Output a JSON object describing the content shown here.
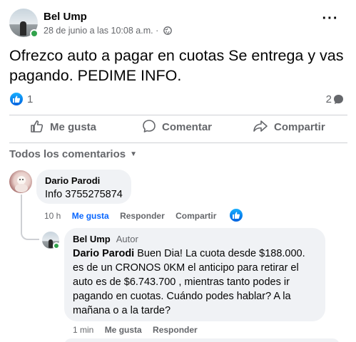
{
  "post": {
    "author": "Bel Ump",
    "timestamp": "28 de junio a las 10:08 a.m.",
    "separator": "·",
    "text": "Ofrezco auto a pagar en cuotas Se entrega y vas pagando. PEDIME INFO.",
    "reaction_count": "1",
    "comment_count": "2"
  },
  "actions": {
    "like": "Me gusta",
    "comment": "Comentar",
    "share": "Compartir"
  },
  "comments_header": "Todos los comentarios",
  "comments": [
    {
      "author": "Dario Parodi",
      "text": "Info 3755275874",
      "time": "10 h",
      "like": "Me gusta",
      "reply": "Responder",
      "share": "Compartir"
    }
  ],
  "reply": {
    "author": "Bel Ump",
    "author_tag": "Autor",
    "mention": "Dario Parodi",
    "text": " Buen Dia! La cuota desde $188.000. es de un CRONOS 0KM el anticipo para retirar el auto es de $6.743.700 , mientras tanto podes ir pagando en cuotas. Cuándo podes hablar? A la mañana o a la tarde?",
    "time": "1 min",
    "like": "Me gusta",
    "reply": "Responder"
  },
  "colors": {
    "accent": "#0866ff",
    "secondary_text": "#65676b",
    "bubble": "#f0f2f5",
    "online": "#31a24c"
  },
  "icons": [
    "globe-icon",
    "more-icon",
    "like-icon",
    "comment-icon",
    "share-icon",
    "caret-down-icon"
  ]
}
